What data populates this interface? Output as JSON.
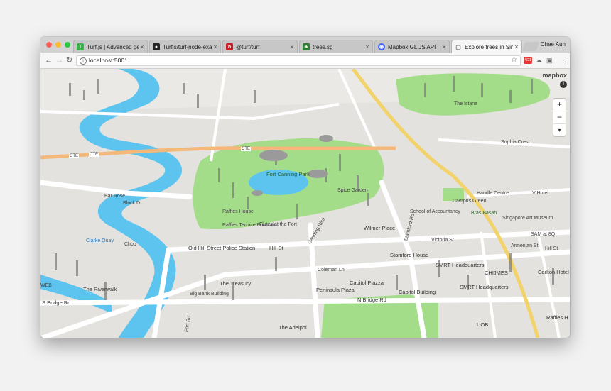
{
  "browser": {
    "tabs": [
      {
        "icon": "turf-icon",
        "glyph": "T",
        "color": "#3bb14a",
        "title": "Turf.js | Advanced geo"
      },
      {
        "icon": "github-icon",
        "glyph": "●",
        "color": "#222222",
        "title": "Turfjs/turf-node-exam"
      },
      {
        "icon": "npm-icon",
        "glyph": "n",
        "color": "#c12127",
        "title": "@turf/turf"
      },
      {
        "icon": "leaf-icon",
        "glyph": "❧",
        "color": "#2e7d32",
        "title": "trees.sg"
      },
      {
        "icon": "mapbox-icon",
        "glyph": "◉",
        "color": "#4264fb",
        "title": "Mapbox GL JS API"
      },
      {
        "icon": "page-icon",
        "glyph": "▢",
        "color": "#888888",
        "title": "Explore trees in Singa"
      }
    ],
    "profile_name": "Chee Aun",
    "url": "localhost:5001"
  },
  "map": {
    "attribution_logo": "mapbox",
    "zoom_in": "+",
    "zoom_out": "−",
    "compass": "▾",
    "labels": {
      "fort_canning_park": "Fort Canning Park",
      "old_hill_street_police_station": "Old Hill Street Police Station",
      "the_riverwalk": "The Riverwalk",
      "the_treasury": "The Treasury",
      "capitol_piazza": "Capitol Piazza",
      "capitol_building": "Capitol Building",
      "peninsula_plaza": "Peninsula Plaza",
      "the_adelphi": "The Adelphi",
      "n_bridge_rd": "N Bridge Rd",
      "s_bridge_rd": "S Bridge Rd",
      "hill_st": "Hill St",
      "wilmer_place": "Wilmer Place",
      "stamford_house": "Stamford House",
      "smrt_headquarters_1": "SMRT Headquarters",
      "smrt_headquarters_2": "SMRT Headquarters",
      "chijmes": "CHIJMES",
      "carlton_hotel": "Carlton Hotel",
      "raffles_h": "Raffles H",
      "uob": "UOB",
      "sam_at_8q": "SAM at 8Q",
      "armenian_st": "Armenian St",
      "singapore_art_museum": "Singapore Art Museum",
      "bras_basah": "Bras Basah",
      "school_of_accountancy": "School of Accountancy",
      "campus_green": "Campus Green",
      "handle_centre": "Handle Centre",
      "v_hotel": "V Hotel",
      "spice_garden": "Spice Garden",
      "raffles_house": "Raffles House",
      "raffles_terrace_fountain": "Raffles Terrace Fountain",
      "flutes_at_the_fort": "Flutes at the Fort",
      "clarke_quay": "Clarke Quay",
      "chou": "Chou",
      "block_d": "Block D",
      "bar_rose": "Bar Rose",
      "web": "WEB",
      "the_istana": "The Istana",
      "sophia_crest": "Sophia Crest",
      "coleman_ln": "Coleman Ln",
      "canning_rise": "Canning Rise",
      "stamford_rd": "Stamford Rd",
      "victoria_st": "Victoria St",
      "big_bank_building": "Big Bank Building",
      "fort_rd": "Fort Rd",
      "hill_st_2": "Hill St",
      "cte_1": "CTE",
      "cte_2": "CTE",
      "cte_3": "CTE"
    }
  }
}
